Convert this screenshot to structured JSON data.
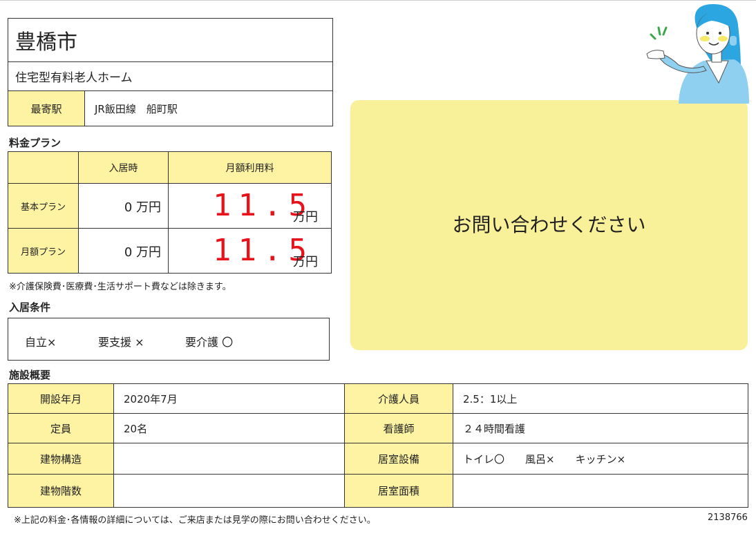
{
  "header": {
    "city": "豊橋市",
    "facility_type": "住宅型有料老人ホーム",
    "station_label": "最寄駅",
    "station_value": "JR飯田線　船町駅"
  },
  "pricing": {
    "section_title": "料金プラン",
    "col_move_in": "入居時",
    "col_monthly": "月額利用料",
    "rows": [
      {
        "label": "基本プラン",
        "move_in": "0 万円",
        "monthly": "11.5",
        "unit": "万円"
      },
      {
        "label": "月額プラン",
        "move_in": "0 万円",
        "monthly": "11.5",
        "unit": "万円"
      }
    ],
    "note": "※介護保険費･医療費･生活サポート費などは除きます。"
  },
  "conditions": {
    "section_title": "入居条件",
    "items": [
      "自立×",
      "要支援 ×",
      "要介護 〇"
    ]
  },
  "contact": {
    "message": "お問い合わせください"
  },
  "overview": {
    "section_title": "施設概要",
    "rows": [
      {
        "l1": "開設年月",
        "v1": "2020年7月",
        "l2": "介護人員",
        "v2": "2.5：1以上"
      },
      {
        "l1": "定員",
        "v1": "20名",
        "l2": "看護師",
        "v2": "２４時間看護"
      },
      {
        "l1": "建物構造",
        "v1": "",
        "l2": "居室設備",
        "v2": "トイレ〇　　風呂×　　キッチン×"
      },
      {
        "l1": "建物階数",
        "v1": "",
        "l2": "居室面積",
        "v2": ""
      }
    ]
  },
  "footer": {
    "note": "※上記の料金･各情報の詳細については、ご来店または見学の際にお問い合わせください。",
    "id": "2138766"
  },
  "colors": {
    "label_bg": "#fdf3a3",
    "price_red": "#e8121b",
    "contact_bg": "#f9f09a",
    "person_blue": "#5cc0e8"
  },
  "icons": {
    "illustration": "woman-presenting-illustration"
  }
}
